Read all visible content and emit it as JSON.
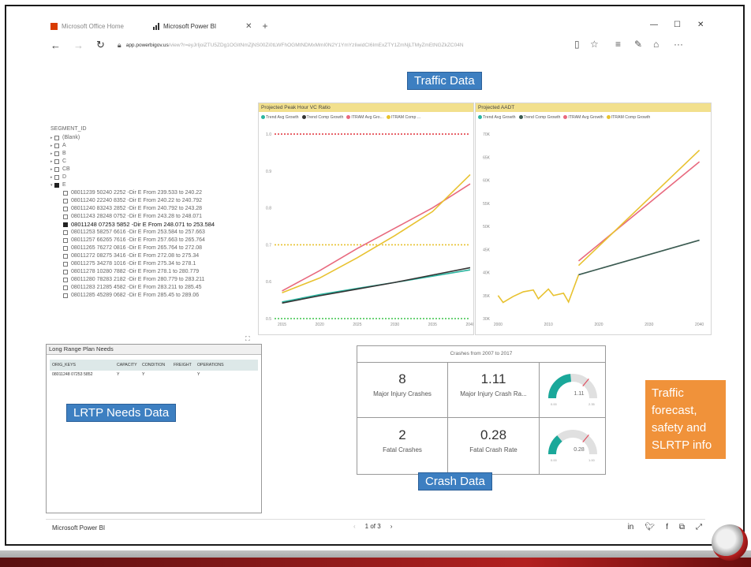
{
  "browser": {
    "tabs": [
      {
        "label": "Microsoft Office Home",
        "active": false
      },
      {
        "label": "Microsoft Power BI",
        "active": true
      }
    ],
    "url_domain": "app.powerbigov.us",
    "url_rest": "/view?r=eyJrIjoiZTU5ZDg1OGItNmZjNS00Zi0tLWFhOGMtNDMxMmI0N2Y1YmYzIiwidCI6ImExZTY1ZmNjLTMyZmEtNGZkZC04N"
  },
  "slicer": {
    "title": "SEGMENT_ID",
    "groups": [
      {
        "label": "(Blank)",
        "checked": false,
        "expanded": false
      },
      {
        "label": "A",
        "checked": false,
        "expanded": false
      },
      {
        "label": "B",
        "checked": false,
        "expanded": false
      },
      {
        "label": "C",
        "checked": false,
        "expanded": false
      },
      {
        "label": "CB",
        "checked": false,
        "expanded": false
      },
      {
        "label": "D",
        "checked": false,
        "expanded": false
      },
      {
        "label": "E",
        "checked": true,
        "expanded": true
      }
    ],
    "items": [
      {
        "label": "08011239 50240 2252 -Dir E From 239.533 to 240.22",
        "checked": false
      },
      {
        "label": "08011240 22240 8352 -Dir E From 240.22 to 240.792",
        "checked": false
      },
      {
        "label": "08011240 83243 2852 -Dir E From 240.792 to 243.28",
        "checked": false
      },
      {
        "label": "08011243 28248 0752 -Dir E From 243.28 to 248.071",
        "checked": false
      },
      {
        "label": "08011248 07253 5852 -Dir E From 248.071 to 253.584",
        "checked": true
      },
      {
        "label": "08011253 58257 6616 -Dir E From 253.584 to 257.663",
        "checked": false
      },
      {
        "label": "08011257 66265 7616 -Dir E From 257.663 to 265.764",
        "checked": false
      },
      {
        "label": "08011265 76272 0816 -Dir E From 265.764 to 272.08",
        "checked": false
      },
      {
        "label": "08011272 08275 3416 -Dir E From 272.08 to 275.34",
        "checked": false
      },
      {
        "label": "08011275 34278 1016 -Dir E From 275.34 to 278.1",
        "checked": false
      },
      {
        "label": "08011278 10280 7882 -Dir E From 278.1 to 280.779",
        "checked": false
      },
      {
        "label": "08011280 78283 2182 -Dir E From 280.779 to 283.211",
        "checked": false
      },
      {
        "label": "08011283 21285 4582 -Dir E From 283.211 to 285.45",
        "checked": false
      },
      {
        "label": "08011285 45289 0682 -Dir E From 285.45 to 289.06",
        "checked": false
      }
    ]
  },
  "overlays": {
    "traffic": "Traffic Data",
    "lrtp": "LRTP Needs Data",
    "crash": "Crash Data",
    "summary_lines": [
      "Traffic",
      "forecast,",
      "safety and",
      "SLRTP info"
    ]
  },
  "chart_data": [
    {
      "type": "line",
      "title": "Projected Peak Hour VC Ratio",
      "legend": [
        "Trend Avg Growth",
        "Trend Comp Growth",
        "ITRAM Avg Gro...",
        "ITRAM Comp ..."
      ],
      "xticks": [
        "2015",
        "2020",
        "2025",
        "2030",
        "2035",
        "2040"
      ],
      "yticks": [
        "0.5",
        "0.6",
        "0.7",
        "0.8",
        "0.9",
        "1.0"
      ],
      "xlim": [
        2014,
        2040
      ],
      "ylim": [
        0.5,
        1.0
      ],
      "colors": {
        "trend_avg": "#2bb5a0",
        "trend_comp": "#333333",
        "itram_avg": "#e8697e",
        "itram_comp": "#e8c230"
      },
      "reference_lines": [
        {
          "y": 1.0,
          "color": "#e0303a"
        },
        {
          "y": 0.7,
          "color": "#e8c230"
        },
        {
          "y": 0.5,
          "color": "#3cc34a"
        }
      ],
      "series": [
        {
          "name": "Trend Avg Growth",
          "x": [
            2015,
            2020,
            2025,
            2030,
            2035,
            2040
          ],
          "y": [
            0.545,
            0.565,
            0.582,
            0.598,
            0.615,
            0.632
          ]
        },
        {
          "name": "Trend Comp Growth",
          "x": [
            2015,
            2020,
            2025,
            2030,
            2035,
            2040
          ],
          "y": [
            0.542,
            0.562,
            0.58,
            0.598,
            0.618,
            0.638
          ]
        },
        {
          "name": "ITRAM Avg Gro...",
          "x": [
            2015,
            2020,
            2025,
            2030,
            2035,
            2040
          ],
          "y": [
            0.575,
            0.63,
            0.69,
            0.745,
            0.8,
            0.865
          ]
        },
        {
          "name": "ITRAM Comp ...",
          "x": [
            2015,
            2020,
            2025,
            2030,
            2035,
            2040
          ],
          "y": [
            0.57,
            0.61,
            0.665,
            0.725,
            0.79,
            0.89
          ]
        }
      ]
    },
    {
      "type": "line",
      "title": "Projected AADT",
      "legend": [
        "Trend Avg Growth",
        "Trend Comp Growth",
        "ITRAM Avg Growth",
        "ITRAM Comp Growth"
      ],
      "xticks": [
        "2000",
        "2010",
        "2020",
        "2030",
        "2040"
      ],
      "yticks": [
        "30K",
        "35K",
        "40K",
        "45K",
        "50K",
        "55K",
        "60K",
        "65K",
        "70K"
      ],
      "xlim": [
        1999,
        2041
      ],
      "ylim": [
        30000,
        70000
      ],
      "colors": {
        "trend_avg": "#2bb5a0",
        "trend_comp": "#3a5a50",
        "itram_avg": "#e8697e",
        "itram_comp": "#e8c230"
      },
      "series": [
        {
          "name": "History",
          "x": [
            2000,
            2001,
            2003,
            2005,
            2007,
            2008,
            2010,
            2011,
            2013,
            2014,
            2016
          ],
          "y": [
            35000,
            33500,
            34800,
            35800,
            36200,
            34300,
            36400,
            35000,
            35500,
            33600,
            39500
          ]
        },
        {
          "name": "Trend Comp Growth",
          "x": [
            2016,
            2040
          ],
          "y": [
            39500,
            47000
          ]
        },
        {
          "name": "ITRAM Avg Growth",
          "x": [
            2016,
            2040
          ],
          "y": [
            42500,
            64000
          ]
        },
        {
          "name": "ITRAM Comp Growth",
          "x": [
            2016,
            2040
          ],
          "y": [
            41500,
            66500
          ]
        }
      ]
    }
  ],
  "lrtp": {
    "title": "Long Range Plan Needs",
    "columns": [
      "ORIG_KEYS",
      "CAPACITY",
      "CONDITION",
      "FREIGHT",
      "OPERATIONS"
    ],
    "rows": [
      [
        "08011248 07253 5852",
        "Y",
        "Y",
        "",
        "Y"
      ]
    ]
  },
  "crash": {
    "title": "Crashes from 2007 to 2017",
    "major_injury_crashes": {
      "value": "8",
      "label": "Major Injury Crashes"
    },
    "major_injury_rate": {
      "value": "1.11",
      "label": "Major Injury Crash Ra..."
    },
    "fatal_crashes": {
      "value": "2",
      "label": "Fatal Crashes"
    },
    "fatal_rate": {
      "value": "0.28",
      "label": "Fatal Crash Rate"
    },
    "gauge1": {
      "value": 1.11,
      "value_label": "1.11",
      "min": "0.00",
      "max": "2.35",
      "fraction": 0.47
    },
    "gauge2": {
      "value": 0.28,
      "value_label": "0.28",
      "min": "0.00",
      "max": "1.00",
      "fraction": 0.28
    }
  },
  "statusbar": {
    "brand": "Microsoft Power BI",
    "page": "1 of 3"
  }
}
